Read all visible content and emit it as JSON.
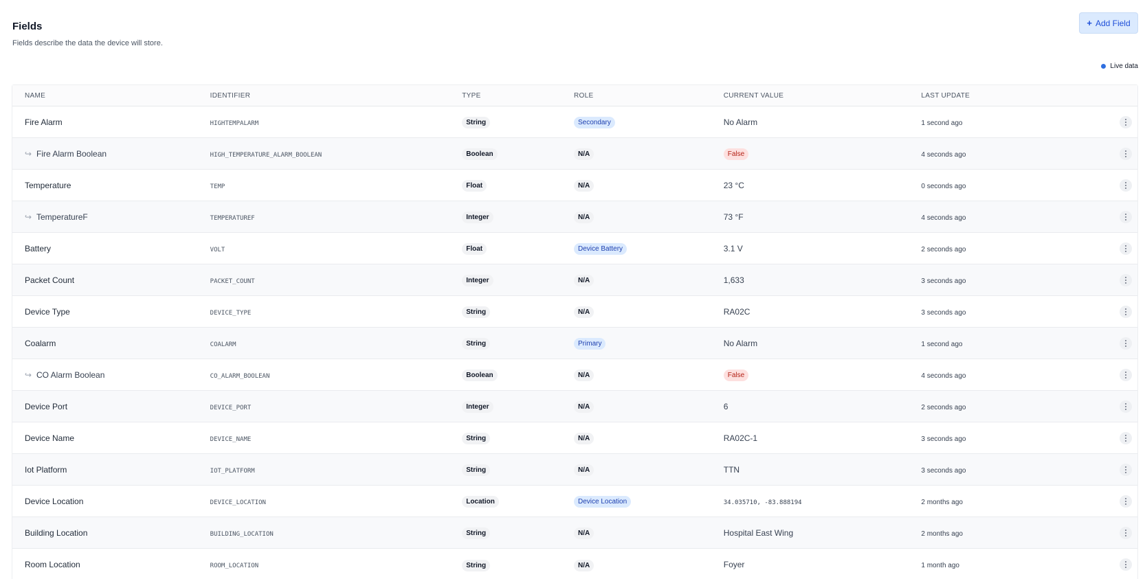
{
  "header": {
    "title": "Fields",
    "subtitle": "Fields describe the data the device will store."
  },
  "actions": {
    "add_field_label": "Add Field",
    "add_icon": "+"
  },
  "live_indicator": {
    "label": "Live data",
    "color": "#2f6fe0"
  },
  "table": {
    "columns": [
      "NAME",
      "IDENTIFIER",
      "TYPE",
      "ROLE",
      "CURRENT VALUE",
      "LAST UPDATE"
    ],
    "rows": [
      {
        "name": "Fire Alarm",
        "child": false,
        "identifier": "HIGHTEMPALARM",
        "type": "String",
        "role": "Secondary",
        "role_kind": "role",
        "value": "No Alarm",
        "value_kind": "text",
        "updated": "1 second ago"
      },
      {
        "name": "Fire Alarm Boolean",
        "child": true,
        "identifier": "HIGH_TEMPERATURE_ALARM_BOOLEAN",
        "type": "Boolean",
        "role": "N/A",
        "role_kind": "na",
        "value": "False",
        "value_kind": "false",
        "updated": "4 seconds ago"
      },
      {
        "name": "Temperature",
        "child": false,
        "identifier": "TEMP",
        "type": "Float",
        "role": "N/A",
        "role_kind": "na",
        "value": "23 °C",
        "value_kind": "text",
        "updated": "0 seconds ago"
      },
      {
        "name": "TemperatureF",
        "child": true,
        "identifier": "TEMPERATUREF",
        "type": "Integer",
        "role": "N/A",
        "role_kind": "na",
        "value": "73 °F",
        "value_kind": "text",
        "updated": "4 seconds ago"
      },
      {
        "name": "Battery",
        "child": false,
        "identifier": "VOLT",
        "type": "Float",
        "role": "Device Battery",
        "role_kind": "role",
        "value": "3.1 V",
        "value_kind": "text",
        "updated": "2 seconds ago"
      },
      {
        "name": "Packet Count",
        "child": false,
        "identifier": "PACKET_COUNT",
        "type": "Integer",
        "role": "N/A",
        "role_kind": "na",
        "value": "1,633",
        "value_kind": "text",
        "updated": "3 seconds ago"
      },
      {
        "name": "Device Type",
        "child": false,
        "identifier": "DEVICE_TYPE",
        "type": "String",
        "role": "N/A",
        "role_kind": "na",
        "value": "RA02C",
        "value_kind": "text",
        "updated": "3 seconds ago"
      },
      {
        "name": "Coalarm",
        "child": false,
        "identifier": "COALARM",
        "type": "String",
        "role": "Primary",
        "role_kind": "role",
        "value": "No Alarm",
        "value_kind": "text",
        "updated": "1 second ago"
      },
      {
        "name": "CO Alarm Boolean",
        "child": true,
        "identifier": "CO_ALARM_BOOLEAN",
        "type": "Boolean",
        "role": "N/A",
        "role_kind": "na",
        "value": "False",
        "value_kind": "false",
        "updated": "4 seconds ago"
      },
      {
        "name": "Device Port",
        "child": false,
        "identifier": "DEVICE_PORT",
        "type": "Integer",
        "role": "N/A",
        "role_kind": "na",
        "value": "6",
        "value_kind": "text",
        "updated": "2 seconds ago"
      },
      {
        "name": "Device Name",
        "child": false,
        "identifier": "DEVICE_NAME",
        "type": "String",
        "role": "N/A",
        "role_kind": "na",
        "value": "RA02C-1",
        "value_kind": "text",
        "updated": "3 seconds ago"
      },
      {
        "name": "Iot Platform",
        "child": false,
        "identifier": "IOT_PLATFORM",
        "type": "String",
        "role": "N/A",
        "role_kind": "na",
        "value": "TTN",
        "value_kind": "text",
        "updated": "3 seconds ago"
      },
      {
        "name": "Device Location",
        "child": false,
        "identifier": "DEVICE_LOCATION",
        "type": "Location",
        "role": "Device Location",
        "role_kind": "role",
        "value": "34.035710, -83.888194",
        "value_kind": "mono",
        "updated": "2 months ago"
      },
      {
        "name": "Building Location",
        "child": false,
        "identifier": "BUILDING_LOCATION",
        "type": "String",
        "role": "N/A",
        "role_kind": "na",
        "value": "Hospital East Wing",
        "value_kind": "text",
        "updated": "2 months ago"
      },
      {
        "name": "Room Location",
        "child": false,
        "identifier": "ROOM_LOCATION",
        "type": "String",
        "role": "N/A",
        "role_kind": "na",
        "value": "Foyer",
        "value_kind": "text",
        "updated": "1 month ago"
      }
    ]
  },
  "icons": {
    "child_indicator": "↪",
    "row_menu": "kebab-menu-icon"
  },
  "colors": {
    "accent": "#1d4ed8",
    "role_pill_bg": "#dbeafe",
    "false_pill_bg": "#fde0df",
    "false_pill_text": "#b42318"
  }
}
